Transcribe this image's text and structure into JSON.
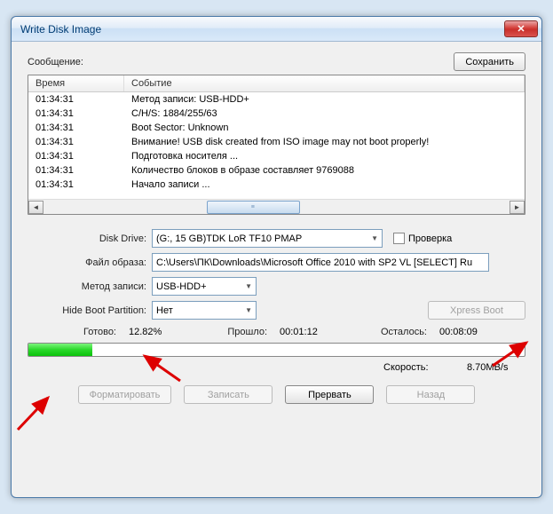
{
  "window": {
    "title": "Write Disk Image"
  },
  "msg": {
    "label": "Сообщение:",
    "save_btn": "Сохранить"
  },
  "log": {
    "columns": {
      "time": "Время",
      "event": "Событие"
    },
    "rows": [
      {
        "time": "01:34:31",
        "event": "Метод записи: USB-HDD+"
      },
      {
        "time": "01:34:31",
        "event": "C/H/S: 1884/255/63"
      },
      {
        "time": "01:34:31",
        "event": "Boot Sector: Unknown"
      },
      {
        "time": "01:34:31",
        "event": "Внимание! USB disk created from ISO image may not boot properly!"
      },
      {
        "time": "01:34:31",
        "event": "Подготовка носителя ..."
      },
      {
        "time": "01:34:31",
        "event": "Количество блоков в образе составляет 9769088"
      },
      {
        "time": "01:34:31",
        "event": "Начало записи ..."
      }
    ]
  },
  "form": {
    "disk_drive": {
      "label": "Disk Drive:",
      "value": "(G:, 15 GB)TDK LoR TF10          PMAP",
      "check_label": "Проверка"
    },
    "image_file": {
      "label": "Файл образа:",
      "value": "C:\\Users\\ПК\\Downloads\\Microsoft Office 2010 with SP2 VL [SELECT] Ru"
    },
    "write_method": {
      "label": "Метод записи:",
      "value": "USB-HDD+"
    },
    "hide_boot": {
      "label": "Hide Boot Partition:",
      "value": "Нет",
      "xpress_btn": "Xpress Boot"
    }
  },
  "status": {
    "ready_label": "Готово:",
    "ready_value": "12.82%",
    "elapsed_label": "Прошло:",
    "elapsed_value": "00:01:12",
    "remaining_label": "Осталось:",
    "remaining_value": "00:08:09",
    "speed_label": "Скорость:",
    "speed_value": "8.70MB/s"
  },
  "buttons": {
    "format": "Форматировать",
    "write": "Записать",
    "abort": "Прервать",
    "back": "Назад"
  }
}
